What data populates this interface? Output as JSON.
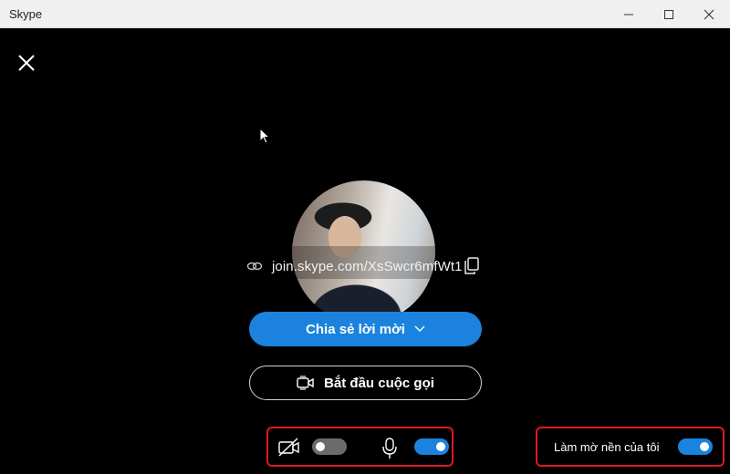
{
  "window": {
    "title": "Skype"
  },
  "meeting": {
    "link": "join.skype.com/XsSwcr6mfWt1",
    "share_label": "Chia sẻ lời mời",
    "start_call_label": "Bắt đầu cuộc gọi"
  },
  "controls": {
    "camera_enabled": false,
    "mic_enabled": true,
    "blur_label": "Làm mờ nền của tôi",
    "blur_enabled": true
  },
  "colors": {
    "accent": "#1b83dd",
    "highlight_border": "#e0191e",
    "background": "#000000"
  },
  "icons": [
    "close-icon",
    "minimize-icon",
    "maximize-icon",
    "link-icon",
    "copy-icon",
    "chevron-down-icon",
    "video-call-icon",
    "camera-off-icon",
    "microphone-icon"
  ]
}
